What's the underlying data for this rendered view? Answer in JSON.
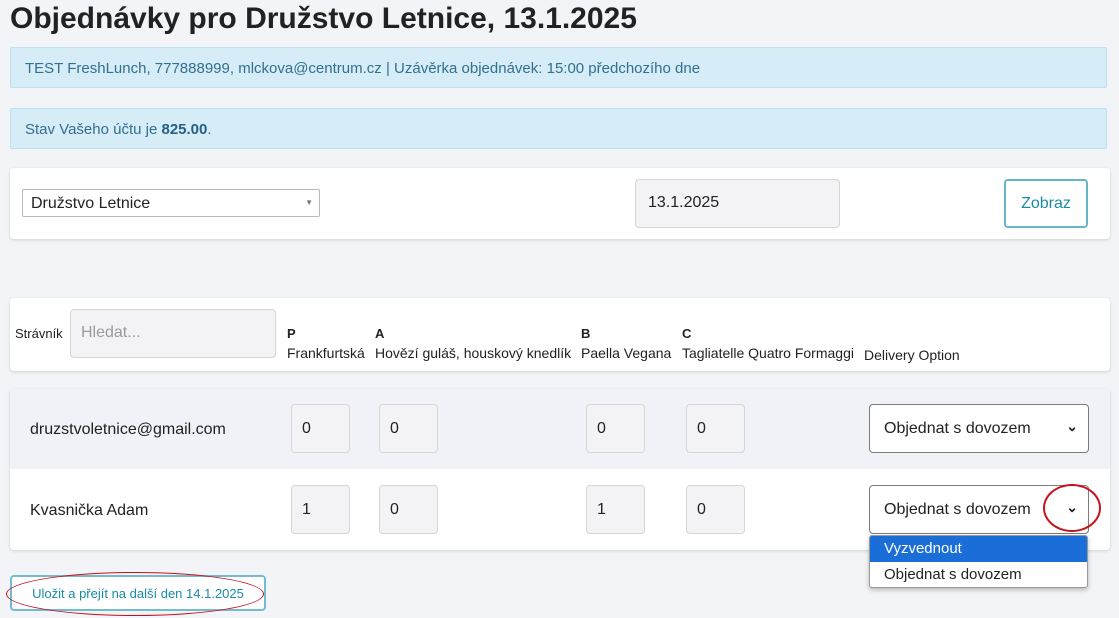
{
  "page_title": "Objednávky pro Družstvo Letnice, 13.1.2025",
  "info_bar": "TEST FreshLunch, 777888999, mlckova@centrum.cz | Uzávěrka objednávek: 15:00 předchozího dne",
  "balance": {
    "prefix": "Stav Vašeho účtu je ",
    "amount": "825.00",
    "suffix": "."
  },
  "filter": {
    "organization_value": "Družstvo Letnice",
    "date_value": "13.1.2025",
    "show_button": "Zobraz"
  },
  "header": {
    "diner_label": "Strávník",
    "search_placeholder": "Hledat...",
    "columns": [
      {
        "code": "P",
        "name": "Frankfurtská"
      },
      {
        "code": "A",
        "name": "Hovězí guláš, houskový knedlík"
      },
      {
        "code": "B",
        "name": "Paella Vegana"
      },
      {
        "code": "C",
        "name": "Tagliatelle Quatro Formaggi"
      }
    ],
    "delivery_label": "Delivery Option"
  },
  "rows": [
    {
      "name": "druzstvoletnice@gmail.com",
      "qty": [
        "0",
        "0",
        "0",
        "0"
      ],
      "delivery": "Objednat s dovozem"
    },
    {
      "name": "Kvasnička Adam",
      "qty": [
        "1",
        "0",
        "1",
        "0"
      ],
      "delivery": "Objednat s dovozem"
    }
  ],
  "dropdown_options": [
    "Vyzvednout",
    "Objednat s dovozem"
  ],
  "save_button": "Uložit a přejít na další den 14.1.2025",
  "colors": {
    "accent": "#1a8aa6",
    "alert_bg": "#d6ecf6",
    "highlight": "#1b6ed8",
    "annotation": "#c8111b"
  }
}
